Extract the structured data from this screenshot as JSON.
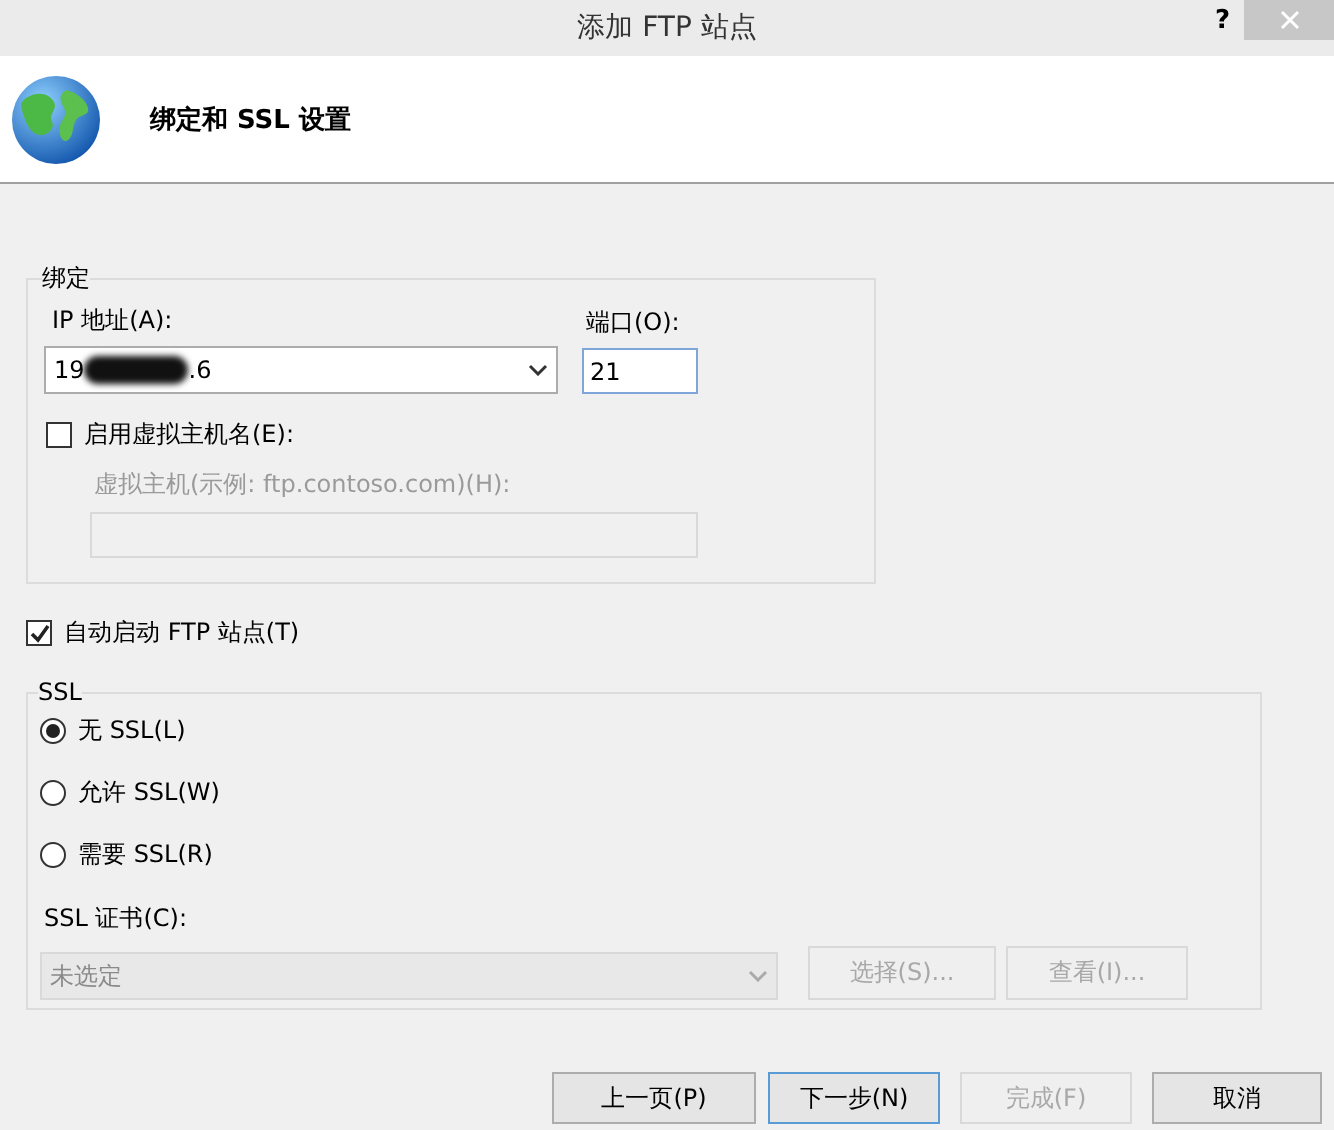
{
  "window": {
    "title": "添加 FTP 站点",
    "help": "?"
  },
  "header": {
    "title": "绑定和 SSL 设置"
  },
  "binding": {
    "legend": "绑定",
    "ip_label": "IP 地址(A):",
    "ip_value_start": "19",
    "ip_value_end": ".6",
    "ip_redacted": true,
    "port_label": "端口(O):",
    "port_value": "21",
    "virtual_host": {
      "label": "启用虚拟主机名(E):",
      "checked": false
    },
    "host_label": "虚拟主机(示例: ftp.contoso.com)(H):",
    "host_disabled": true
  },
  "auto_start": {
    "label": "自动启动 FTP 站点(T)",
    "checked": true
  },
  "ssl": {
    "legend": "SSL",
    "options": [
      {
        "label": "无 SSL(L)",
        "selected": true
      },
      {
        "label": "允许 SSL(W)",
        "selected": false
      },
      {
        "label": "需要 SSL(R)",
        "selected": false
      }
    ],
    "cert_label": "SSL 证书(C):",
    "cert_value": "未选定",
    "cert_disabled": true,
    "buttons": [
      {
        "label": "选择(S)...",
        "disabled": true
      },
      {
        "label": "查看(I)...",
        "disabled": true
      }
    ]
  },
  "footer_buttons": [
    {
      "label": "上一页(P)",
      "disabled": false,
      "focused": false
    },
    {
      "label": "下一步(N)",
      "disabled": false,
      "focused": true
    },
    {
      "label": "完成(F)",
      "disabled": true,
      "focused": false
    },
    {
      "label": "取消",
      "disabled": false,
      "focused": false
    }
  ]
}
